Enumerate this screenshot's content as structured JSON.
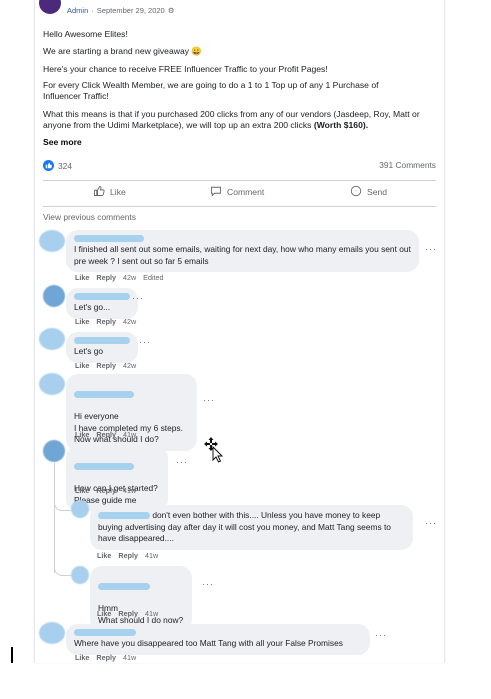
{
  "post": {
    "role": "Admin",
    "date": "September 29, 2020",
    "paragraphs": [
      "Hello Awesome Elites!",
      "We are starting a brand new giveaway 😀",
      "Here's your chance to receive FREE Influencer Traffic to your Profit Pages!",
      "For every Click Wealth Member, we are going to do a 1 to 1 Top up of any 1 Purchase of Influencer Traffic!",
      "What this means is that if you purchased 200 clicks from any of our vendors (Jasdeep, Roy, Matt or anyone from the Udimi Marketplace), we will top up an extra 200 clicks"
    ],
    "worth": "(Worth $160).",
    "see_more": "See more",
    "like_count": "324",
    "comments_count": "391 Comments",
    "actions": {
      "like": "Like",
      "comment": "Comment",
      "send": "Send"
    },
    "view_previous": "View previous comments"
  },
  "comment_actions": {
    "like": "Like",
    "reply": "Reply"
  },
  "comments": [
    {
      "text": "I finished all sent out some emails, waiting for next day, how who many emails you sent out pre week ? I sent out so far 5 emails",
      "time": "42w",
      "edited": "Edited"
    },
    {
      "text": "Let's go...",
      "time": "42w"
    },
    {
      "text": "Let's go",
      "time": "42w"
    },
    {
      "text": "Hi everyone\nI have completed my 6 steps.\nNow what should I do?",
      "time": "41w"
    },
    {
      "text": "How can I get started?\nPlease guide me",
      "time": "41w"
    },
    {
      "text": "don't even bother with this.... Unless you have money to keep buying advertising day after day it will cost you money, and Matt Tang seems to have disappeared....",
      "time": "41w"
    },
    {
      "text": "Hmm\nWhat should I do now?",
      "time": "41w"
    },
    {
      "text": "Where have you disappeared too Matt Tang with all your False Promises",
      "time": "41w"
    }
  ]
}
